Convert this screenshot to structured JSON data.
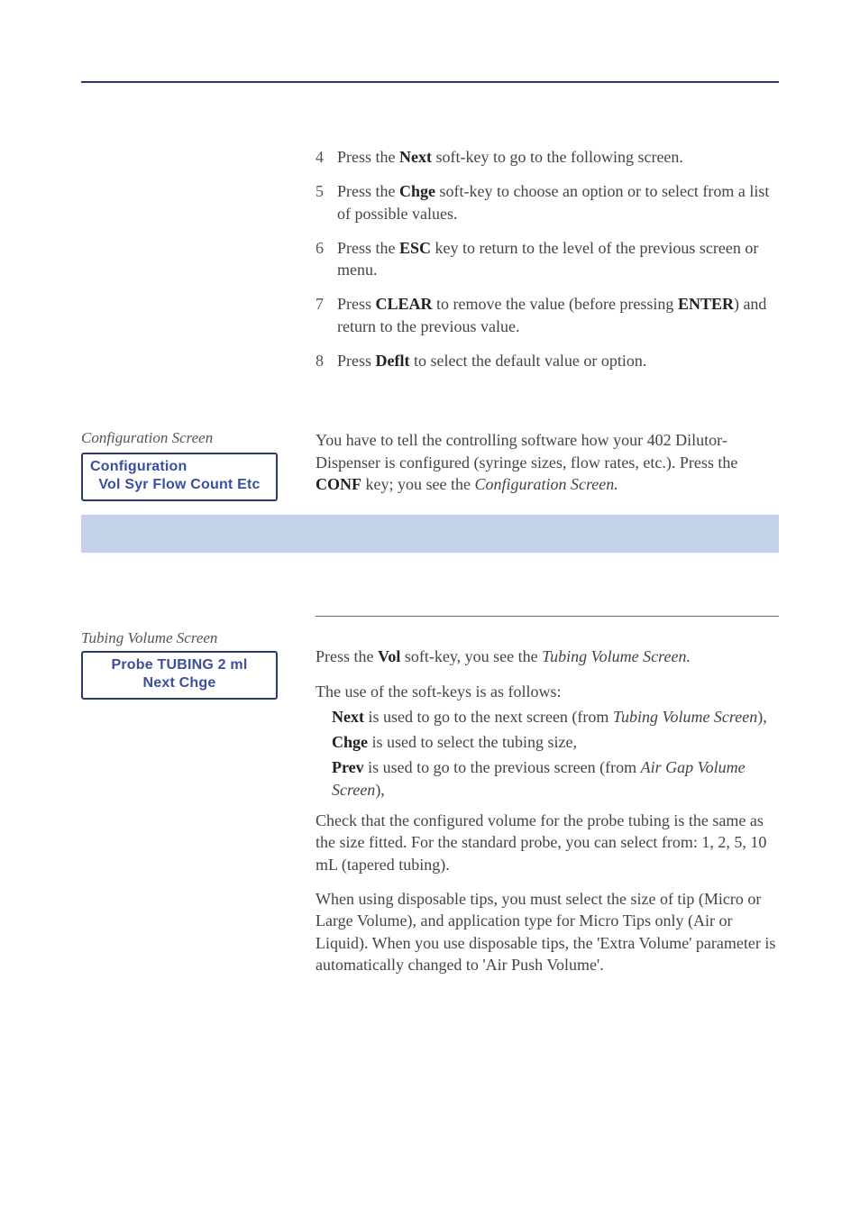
{
  "steps": [
    {
      "num": "4",
      "html": "Press the <b>Next</b> soft-key to go to the following screen."
    },
    {
      "num": "5",
      "html": "Press the <b>Chge</b> soft-key to choose an option or to select from a list of possible values."
    },
    {
      "num": "6",
      "html": "Press the <b>ESC</b> key to return to the level of the previous screen or menu."
    },
    {
      "num": "7",
      "html": "Press <b>CLEAR</b> to remove the value (before pressing <b>ENTER</b>) and return to the previous value."
    },
    {
      "num": "8",
      "html": "Press <b>Deflt</b> to select the default value or option."
    }
  ],
  "config_caption": "Configuration Screen",
  "config_lcd": {
    "line1": "Configuration",
    "line2": "Vol  Syr Flow  Count  Etc"
  },
  "config_para": "You have to tell the controlling software how your 402 Dilutor-Dispenser is configured (syringe sizes, flow rates, etc.). Press the <b>CONF</b> key; you see the <span class=\"ital\">Configuration Screen.</span>",
  "tubing_caption": "Tubing Volume Screen",
  "tubing_lcd": {
    "line1": "Probe TUBING 2 ml",
    "line2": "Next      Chge"
  },
  "tubing_intro": "Press the <b>Vol</b> soft-key, you see the <span class=\"ital\">Tubing Volume Screen.</span>",
  "softkeys_intro": "The use of the soft-keys is as follows:",
  "softkeys": [
    "<b>Next</b> is used to go to the next screen (from <span class=\"ital\">Tubing Volume Screen</span>),",
    "<b>Chge</b> is used to select the tubing size,",
    "<b>Prev</b> is used to go to the previous screen (from <span class=\"ital\">Air Gap Volume Screen</span>),"
  ],
  "tubing_para2": "Check that the configured volume for the probe tubing is the same as the size fitted. For the standard probe, you can select from: 1, 2, 5, 10 mL (tapered tubing).",
  "tubing_para3": "When using disposable tips, you must select the size of tip (Micro or Large Volume), and application type for Micro Tips only (Air or Liquid). When you use disposable tips, the 'Extra Volume' parameter is automatically changed to 'Air Push Volume'."
}
